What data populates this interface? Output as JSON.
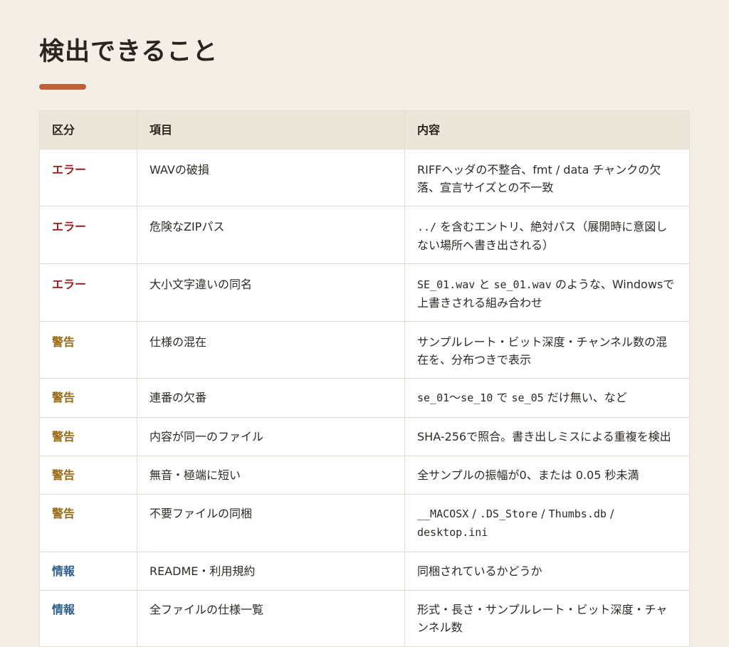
{
  "title": "検出できること",
  "colors": {
    "accent": "#c0603a",
    "error": "#9b1c1c",
    "warning": "#9a6a12",
    "info": "#2e5f8a"
  },
  "table": {
    "headers": [
      "区分",
      "項目",
      "内容"
    ],
    "rows": [
      {
        "category": "エラー",
        "type": "error",
        "item": "WAVの破損",
        "parts": [
          {
            "t": "RIFFヘッダの不整合、fmt / data チャンクの欠落、宣言サイズとの不一致",
            "mono": false
          }
        ]
      },
      {
        "category": "エラー",
        "type": "error",
        "item": "危険なZIPパス",
        "parts": [
          {
            "t": "../",
            "mono": true
          },
          {
            "t": " を含むエントリ、絶対パス（展開時に意図しない場所へ書き出される）",
            "mono": false
          }
        ]
      },
      {
        "category": "エラー",
        "type": "error",
        "item": "大小文字違いの同名",
        "parts": [
          {
            "t": "SE_01.wav",
            "mono": true
          },
          {
            "t": " と ",
            "mono": false
          },
          {
            "t": "se_01.wav",
            "mono": true
          },
          {
            "t": " のような、Windowsで上書きされる組み合わせ",
            "mono": false
          }
        ]
      },
      {
        "category": "警告",
        "type": "warning",
        "item": "仕様の混在",
        "parts": [
          {
            "t": "サンプルレート・ビット深度・チャンネル数の混在を、分布つきで表示",
            "mono": false
          }
        ]
      },
      {
        "category": "警告",
        "type": "warning",
        "item": "連番の欠番",
        "parts": [
          {
            "t": "se_01",
            "mono": true
          },
          {
            "t": "〜",
            "mono": false
          },
          {
            "t": "se_10",
            "mono": true
          },
          {
            "t": " で ",
            "mono": false
          },
          {
            "t": "se_05",
            "mono": true
          },
          {
            "t": " だけ無い、など",
            "mono": false
          }
        ]
      },
      {
        "category": "警告",
        "type": "warning",
        "item": "内容が同一のファイル",
        "parts": [
          {
            "t": "SHA-256で照合。書き出しミスによる重複を検出",
            "mono": false
          }
        ]
      },
      {
        "category": "警告",
        "type": "warning",
        "item": "無音・極端に短い",
        "parts": [
          {
            "t": "全サンプルの振幅が0、または 0.05 秒未満",
            "mono": false
          }
        ]
      },
      {
        "category": "警告",
        "type": "warning",
        "item": "不要ファイルの同梱",
        "parts": [
          {
            "t": "__MACOSX",
            "mono": true
          },
          {
            "t": " / ",
            "mono": false
          },
          {
            "t": ".DS_Store",
            "mono": true
          },
          {
            "t": " / ",
            "mono": false
          },
          {
            "t": "Thumbs.db",
            "mono": true
          },
          {
            "t": " / ",
            "mono": false
          },
          {
            "t": "desktop.ini",
            "mono": true
          }
        ]
      },
      {
        "category": "情報",
        "type": "info",
        "item": "README・利用規約",
        "parts": [
          {
            "t": "同梱されているかどうか",
            "mono": false
          }
        ]
      },
      {
        "category": "情報",
        "type": "info",
        "item": "全ファイルの仕様一覧",
        "parts": [
          {
            "t": "形式・長さ・サンプルレート・ビット深度・チャンネル数",
            "mono": false
          }
        ]
      }
    ]
  }
}
